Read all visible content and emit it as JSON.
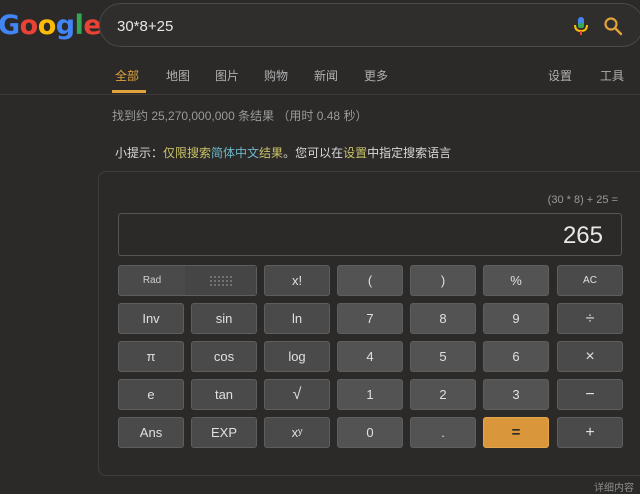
{
  "search": {
    "query": "30*8+25"
  },
  "tabs": [
    {
      "label": "全部",
      "active": true
    },
    {
      "label": "地图"
    },
    {
      "label": "图片"
    },
    {
      "label": "购物"
    },
    {
      "label": "新闻"
    },
    {
      "label": "更多"
    },
    {
      "label": "设置"
    },
    {
      "label": "工具"
    }
  ],
  "results": {
    "stats": "找到约 25,270,000,000 条结果 （用时 0.48 秒）"
  },
  "hint": {
    "prefix": "小提示：",
    "link1": "仅限搜索",
    "link2": "简体中文",
    "link3": "结果",
    "mid": "。您可以在",
    "settings": "设置",
    "suffix": "中指定搜索语言"
  },
  "calculator": {
    "expression": "(30 * 8) + 25 =",
    "result": "265",
    "mode": "Rad",
    "keys": {
      "fact": "x!",
      "lparen": "(",
      "rparen": ")",
      "percent": "%",
      "ac": "AC",
      "inv": "Inv",
      "sin": "sin",
      "ln": "ln",
      "d7": "7",
      "d8": "8",
      "d9": "9",
      "divide": "÷",
      "pi": "π",
      "cos": "cos",
      "log": "log",
      "d4": "4",
      "d5": "5",
      "d6": "6",
      "multiply": "×",
      "e": "e",
      "tan": "tan",
      "sqrt": "√",
      "d1": "1",
      "d2": "2",
      "d3": "3",
      "minus": "−",
      "ans": "Ans",
      "exp": "EXP",
      "pow": "xʸ",
      "d0": "0",
      "dot": ".",
      "equals": "=",
      "plus": "+"
    }
  },
  "footer": {
    "more": "详细内容"
  },
  "colors": {
    "accent": "#e2a23a",
    "background": "#2b2a29"
  }
}
